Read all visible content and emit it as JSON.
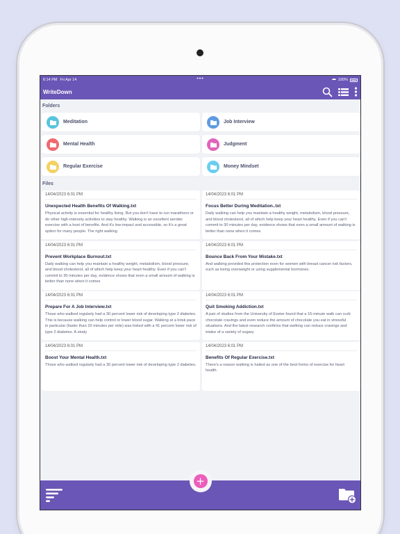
{
  "status_bar": {
    "time": "6:14 PM",
    "date": "Fri Apr 14",
    "dots": "•••",
    "battery": "100%"
  },
  "app": {
    "title": "WriteDown"
  },
  "sections": {
    "folders": "Folders",
    "files": "Files"
  },
  "folders": [
    {
      "name": "Meditation",
      "color": "#5ac4de"
    },
    {
      "name": "Job Interview",
      "color": "#5f9be3"
    },
    {
      "name": "Mental Health",
      "color": "#ee6a6f"
    },
    {
      "name": "Judgment",
      "color": "#e063ba"
    },
    {
      "name": "Regular Exercise",
      "color": "#f3d163"
    },
    {
      "name": "Money Mindset",
      "color": "#69cdf0"
    }
  ],
  "files": [
    {
      "date": "14/04/2023 6:01 PM",
      "title": "Unexpected Health Benefits Of Walking.txt",
      "preview": "Physical activity is essential for healthy living. But you don't have to run marathons or do other high-intensity activities to stay healthy. Walking is an excellent aerobic exercise with a host of benefits. And it's low-impact and accessible, so it's a great option for many people. The right walking"
    },
    {
      "date": "14/04/2023 6:01 PM",
      "title": "Focus Better During Meditation..txt",
      "preview": "Daily walking can help you maintain a healthy weight, metabolism, blood pressure, and blood cholesterol, all of which help keep your heart healthy. Even if you can't commit to 30 minutes per day, evidence shows that even a small amount of walking is better than none when it comes"
    },
    {
      "date": "14/04/2023 6:01 PM",
      "title": "Prevent Workplace Burnout.txt",
      "preview": "Daily walking can help you maintain a healthy weight, metabolism, blood pressure, and blood cholesterol, all of which help keep your heart healthy. Even if you can't commit to 30 minutes per day, evidence shows that even a small amount of walking is better than none when it comes"
    },
    {
      "date": "14/04/2023 6:01 PM",
      "title": "Bounce Back From Your Mistake.txt",
      "preview": "And walking provided this protection even for women with breast cancer risk factors, such as being overweight or using supplemental hormones."
    },
    {
      "date": "14/04/2023 6:01 PM",
      "title": "Prepare For A Job Interview.txt",
      "preview": "Those who walked regularly had a 30 percent lower risk of developing type 2 diabetes. This is because walking can help control or lower blood sugar. Walking at a brisk pace in particular (faster than 20 minutes per mile) was linked with a 41 percent lower risk of type 2 diabetes. A study"
    },
    {
      "date": "14/04/2023 6:01 PM",
      "title": "Quit Smoking Addiction.txt",
      "preview": "A pair of studies from the University of Exeter found that a 15-minute walk can curb chocolate cravings and even reduce the amount of chocolate you eat in stressful situations. And the latest research confirms that walking can reduce cravings and intake of a variety of sugary"
    },
    {
      "date": "14/04/2023 6:01 PM",
      "title": "Boost Your Mental Health.txt",
      "preview": "Those who walked regularly had a 30 percent lower risk of developing type 2 diabetes."
    },
    {
      "date": "14/04/2023 6:01 PM",
      "title": "Benefits Of Regular Exercise.txt",
      "preview": "There's a reason walking is hailed as one of the best forms of exercise for heart health."
    }
  ],
  "fab": {
    "label": "+"
  },
  "icons": {
    "search": "search-icon",
    "list_view": "list-view-icon",
    "more": "more-vertical-icon",
    "sort": "sort-icon",
    "new_folder": "add-folder-icon",
    "folder": "folder-icon"
  },
  "colors": {
    "primary": "#6a56b6",
    "fab": "#ec5dbc",
    "background": "#f1f2f6"
  }
}
